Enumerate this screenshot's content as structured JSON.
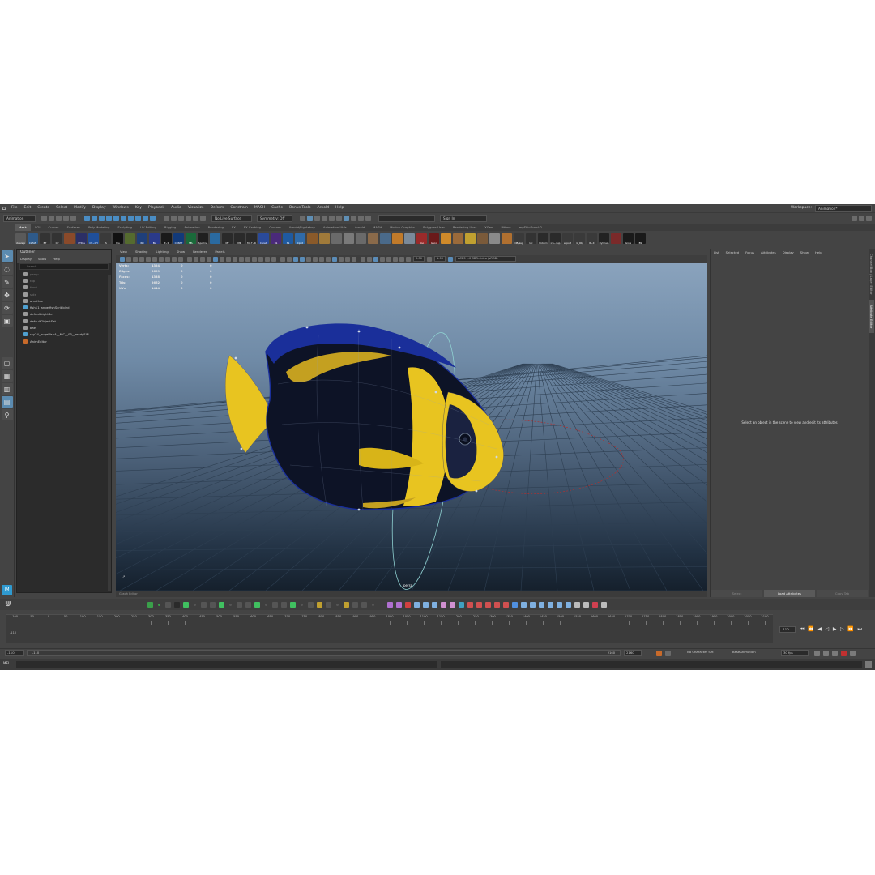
{
  "menubar": {
    "items": [
      "File",
      "Edit",
      "Create",
      "Select",
      "Modify",
      "Display",
      "Windows",
      "Key",
      "Playback",
      "Audio",
      "Visualize",
      "Deform",
      "Constrain",
      "MASH",
      "Cache",
      "Bonus Tools",
      "Arnold",
      "Help"
    ],
    "workspace_label": "Workspace:",
    "workspace_value": "Animation*"
  },
  "statusline": {
    "menuset": "Animation",
    "live_surface": "No Live Surface",
    "symmetry": "Symmetry: Off",
    "sign_in": "Sign In"
  },
  "shelf": {
    "tabs": [
      "Mask",
      "XGI",
      "Curves",
      "Surfaces",
      "Poly Modeling",
      "Sculpting",
      "UV Editing",
      "Rigging",
      "Animation",
      "Rendering",
      "FX",
      "FX Caching",
      "Custom",
      "Arnold/Lightshop",
      "Animation Utils",
      "Arnold",
      "MASH",
      "Motion Graphics",
      "Polygons User",
      "Rendering User",
      "XGen",
      "Bifrost",
      "mySkinToolsV2"
    ],
    "active_tab": "Mask",
    "icons": [
      {
        "label": "cleanup",
        "color": "#5a5a5a"
      },
      {
        "label": "CLEAN",
        "color": "#2e5a8a"
      },
      {
        "label": "BT",
        "color": "#333333"
      },
      {
        "label": "CP",
        "color": "#333333"
      },
      {
        "label": "",
        "color": "#8a4a2a"
      },
      {
        "label": "CTRLs",
        "color": "#2b2f66"
      },
      {
        "label": "CV~CH",
        "color": "#1f4f9a"
      },
      {
        "label": "JS",
        "color": "#3a3a3a"
      },
      {
        "label": "Bla",
        "color": "#111111"
      },
      {
        "label": "",
        "color": "#556b2f"
      },
      {
        "label": "RD",
        "color": "#1f3f7a"
      },
      {
        "label": "BL",
        "color": "#2a3a8a"
      },
      {
        "label": "P~S",
        "color": "#1a1a1a"
      },
      {
        "label": "CONST",
        "color": "#123a7a"
      },
      {
        "label": "SEL",
        "color": "#1a6a3a"
      },
      {
        "label": "Spotline",
        "color": "#1f1f1f"
      },
      {
        "label": "",
        "color": "#2a6aa0"
      },
      {
        "label": "MT",
        "color": "#2a2a2a"
      },
      {
        "label": "MK",
        "color": "#2a2a2a"
      },
      {
        "label": "M~T~R",
        "color": "#2a2a2a"
      },
      {
        "label": "Constr",
        "color": "#2a4a9a"
      },
      {
        "label": "SS",
        "color": "#4a2a7a"
      },
      {
        "label": "SS",
        "color": "#1f5aa0"
      },
      {
        "label": "CpEd",
        "color": "#2f6aa8"
      },
      {
        "label": "",
        "color": "#8a5a2a"
      },
      {
        "label": "",
        "color": "#a07a3a"
      },
      {
        "label": "",
        "color": "#6a6a6a"
      },
      {
        "label": "",
        "color": "#7a7a7a"
      },
      {
        "label": "",
        "color": "#6a6a6a"
      },
      {
        "label": "",
        "color": "#8a6a4a"
      },
      {
        "label": "",
        "color": "#4a6a8a"
      },
      {
        "label": "",
        "color": "#c07a2a"
      },
      {
        "label": "",
        "color": "#7a8a9a"
      },
      {
        "label": "Boo",
        "color": "#9a2a2a"
      },
      {
        "label": "Geco",
        "color": "#6a1a1a"
      },
      {
        "label": "",
        "color": "#d08a2a"
      },
      {
        "label": "",
        "color": "#9a6a3a"
      },
      {
        "label": "",
        "color": "#c0a030"
      },
      {
        "label": "",
        "color": "#7a5a3a"
      },
      {
        "label": "",
        "color": "#8a8a8a"
      },
      {
        "label": "",
        "color": "#b07030"
      },
      {
        "label": "OB/Seg",
        "color": "#3a3a3a"
      },
      {
        "label": "loc",
        "color": "#333333"
      },
      {
        "label": "Blckbm",
        "color": "#2a2a2a"
      },
      {
        "label": "ice~dup",
        "color": "#2a2a2a"
      },
      {
        "label": "export",
        "color": "#3a3a3a"
      },
      {
        "label": "G_Obj",
        "color": "#3a3a3a"
      },
      {
        "label": "R~X",
        "color": "#3a3a3a"
      },
      {
        "label": "DyChain",
        "color": "#222222"
      },
      {
        "label": "",
        "color": "#7a2a2a"
      },
      {
        "label": "Grow",
        "color": "#1a1a1a"
      },
      {
        "label": "BS",
        "color": "#1a1a1a"
      }
    ]
  },
  "toolbox": {
    "tools": [
      "select-arrow",
      "lasso",
      "paint",
      "move",
      "rotate",
      "scale"
    ],
    "badge": "JM"
  },
  "outliner": {
    "title": "Outliner",
    "menu": [
      "Display",
      "Show",
      "Help"
    ],
    "search_placeholder": "Search...",
    "items": [
      {
        "label": "persp",
        "dim": true
      },
      {
        "label": "top",
        "dim": true
      },
      {
        "label": "front",
        "dim": true
      },
      {
        "label": "side",
        "dim": true
      },
      {
        "label": "anmHes",
        "dim": false
      },
      {
        "label": "fish11_angelfishScribbled",
        "dim": false
      },
      {
        "label": "defaultLightSet",
        "dim": false
      },
      {
        "label": "defaultObjectSet",
        "dim": false
      },
      {
        "label": "bats",
        "dim": false
      },
      {
        "label": "ray24_angelfishA__NIC__03__readyFIN",
        "dim": false
      },
      {
        "label": "AnimEditor",
        "dim": false
      }
    ]
  },
  "viewport": {
    "menu": [
      "View",
      "Shading",
      "Lighting",
      "Show",
      "Renderer",
      "Panels"
    ],
    "field_a": "0.00",
    "field_b": "1.00",
    "colorspace": "ACES 1.0 SDR-video (sRGB)",
    "hud": [
      {
        "label": "Verts:",
        "a": "1324",
        "b": "0",
        "c": "0"
      },
      {
        "label": "Edges:",
        "a": "2609",
        "b": "0",
        "c": "0"
      },
      {
        "label": "Faces:",
        "a": "1338",
        "b": "0",
        "c": "0"
      },
      {
        "label": "Tris:",
        "a": "2662",
        "b": "0",
        "c": "0"
      },
      {
        "label": "UVs:",
        "a": "1444",
        "b": "0",
        "c": "0"
      }
    ],
    "camera": "persp",
    "colors": {
      "fish_body": "#0d1326",
      "fish_blue": "#1a2f9a",
      "fish_yellow": "#e8c420",
      "grid": "#2e3f52"
    }
  },
  "attribute_editor": {
    "menu": [
      "List",
      "Selected",
      "Focus",
      "Attributes",
      "Display",
      "Show",
      "Help"
    ],
    "message": "Select an object in the scene to view and edit its attributes",
    "buttons": [
      "Select",
      "Load Attributes",
      "Copy Tab"
    ],
    "side_tabs": [
      "Channel Box / Layer Editor",
      "Attribute Editor"
    ]
  },
  "script_strip": "Graph Editor",
  "timeline": {
    "ticks": [
      "-100",
      "-50",
      "0",
      "50",
      "100",
      "150",
      "200",
      "250",
      "300",
      "350",
      "400",
      "450",
      "500",
      "550",
      "600",
      "650",
      "700",
      "750",
      "800",
      "850",
      "900",
      "950",
      "1000",
      "1050",
      "1100",
      "1150",
      "1200",
      "1250",
      "1300",
      "1350",
      "1400",
      "1450",
      "1500",
      "1550",
      "1600",
      "1650",
      "1700",
      "1750",
      "1800",
      "1850",
      "1900",
      "1950",
      "2000",
      "2050",
      "2100"
    ],
    "left_marker": "-110",
    "current_frame": "-110"
  },
  "range": {
    "start": "-110",
    "inner_start": "-110",
    "inner_end": "2160",
    "end": "2160",
    "character_set": "No Character Set",
    "anim_layer": "BaseAnimation",
    "fps": "30 fps"
  },
  "cmdline": {
    "language": "MEL"
  }
}
